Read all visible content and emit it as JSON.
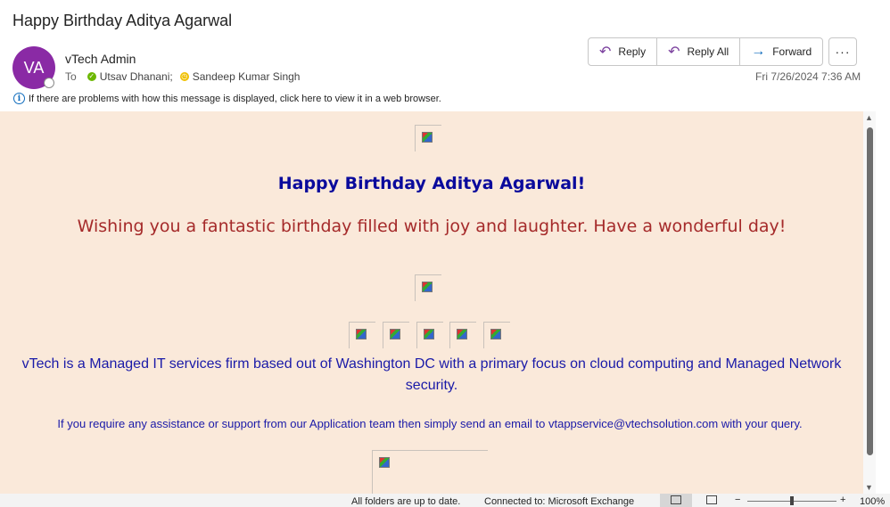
{
  "email": {
    "subject": "Happy Birthday Aditya Agarwal",
    "avatar_initials": "VA",
    "sender": "vTech Admin",
    "to_label": "To",
    "recipients": [
      "Utsav Dhanani;",
      "Sandeep Kumar Singh"
    ],
    "info_notice": "If there are problems with how this message is displayed, click here to view it in a web browser.",
    "date": "Fri 7/26/2024 7:36 AM"
  },
  "actions": {
    "reply": "Reply",
    "reply_all": "Reply All",
    "forward": "Forward",
    "more": "···"
  },
  "message": {
    "heading": "Happy Birthday Aditya Agarwal!",
    "wish": "Wishing you a fantastic birthday filled with joy and laughter. Have a wonderful day!",
    "about": "vTech is a Managed IT services firm based out of Washington DC with a primary focus on cloud computing and Managed Network security.",
    "support": "If you require any assistance or support from our Application team then simply send an email to vtappservice@vtechsolution.com with your query."
  },
  "status_bar": {
    "sync": "All folders are up to date.",
    "connection": "Connected to: Microsoft Exchange",
    "zoom_minus": "−",
    "zoom_plus": "+",
    "zoom": "100%"
  },
  "colors": {
    "avatar": "#8a2aa5",
    "body_background": "#fae9da",
    "heading": "#0a0a9c",
    "wish": "#a52a2a",
    "about": "#1a1aa8"
  }
}
